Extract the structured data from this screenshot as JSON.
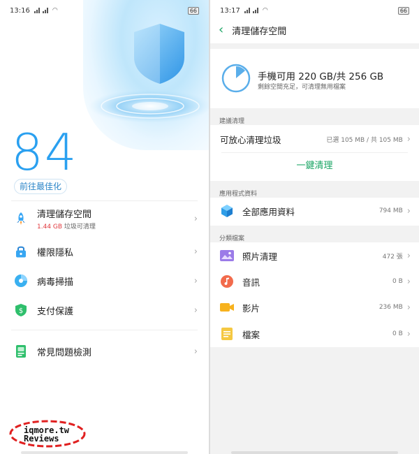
{
  "left": {
    "status": {
      "time": "13:16",
      "battery": "66"
    },
    "score": "84",
    "optimize_label": "前往最佳化",
    "menu": [
      {
        "title": "清理儲存空間",
        "sub_red": "1.44 GB",
        "sub_rest": " 垃圾可清理"
      },
      {
        "title": "權限隱私"
      },
      {
        "title": "病毒掃描"
      },
      {
        "title": "支付保護"
      },
      {
        "title": "常見問題檢測"
      }
    ],
    "watermark": {
      "line1": "iqmore.tw",
      "line2": "Reviews"
    }
  },
  "right": {
    "status": {
      "time": "13:17",
      "battery": "66"
    },
    "title": "清理儲存空間",
    "storage": {
      "main": "手機可用 220 GB/共 256 GB",
      "sub": "剩餘空間充足，可清理無用檔案",
      "used_fraction": 0.14
    },
    "suggest": {
      "section": "建議清理",
      "row_label": "可放心清理垃圾",
      "row_value": "已選 105 MB / 共 105 MB",
      "button": "一鍵清理"
    },
    "app_data": {
      "section": "應用程式資料",
      "label": "全部應用資料",
      "value": "794 MB"
    },
    "categories": {
      "section": "分類檔案",
      "items": [
        {
          "label": "照片清理",
          "value": "472 張",
          "icon": "photo-icon",
          "color": "#9b7be8"
        },
        {
          "label": "音訊",
          "value": "0 B",
          "icon": "music-icon",
          "color": "#f26b4c"
        },
        {
          "label": "影片",
          "value": "236 MB",
          "icon": "video-icon",
          "color": "#f7b21e"
        },
        {
          "label": "檔案",
          "value": "0 B",
          "icon": "document-icon",
          "color": "#f5c842"
        }
      ]
    }
  },
  "colors": {
    "accent_blue": "#2aa0f0",
    "accent_green": "#1aa564",
    "warning_red": "#e0393e"
  }
}
